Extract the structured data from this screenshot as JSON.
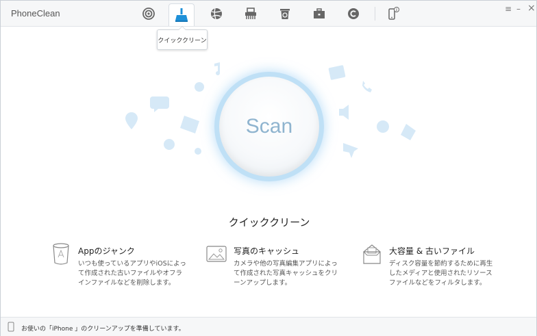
{
  "app": {
    "title": "PhoneClean"
  },
  "toolbar": {
    "items": [
      {
        "icon": "antenna-icon"
      },
      {
        "icon": "broom-icon",
        "active": true
      },
      {
        "icon": "globe-icon"
      },
      {
        "icon": "shredder-icon"
      },
      {
        "icon": "trash-recycle-icon"
      },
      {
        "icon": "toolbox-icon"
      },
      {
        "icon": "refresh-c-icon"
      },
      {
        "icon": "phone-info-icon"
      }
    ],
    "tooltip": "クイッククリーン"
  },
  "window_controls": {
    "menu": "≡",
    "minimize": "–",
    "close": "×"
  },
  "main": {
    "scan_label": "Scan",
    "section_title": "クイッククリーン",
    "features": [
      {
        "icon": "app-trash-icon",
        "title": "Appのジャンク",
        "desc": "いつも使っているアプリやiOSによって作成された古いファイルやオフラインファイルなどを削除します。"
      },
      {
        "icon": "photo-icon",
        "title": "写真のキャッシュ",
        "desc": "カメラや他の写真編集アプリによって作成された写真キャッシュをクリーンアップします。"
      },
      {
        "icon": "storage-box-icon",
        "title": "大容量 & 古いファイル",
        "desc": "ディスク容量を節約するために再生したメディアと使用されたリソースファイルなどをフィルタします。"
      }
    ]
  },
  "status": {
    "text": "お使いの「iPhone 」のクリーンアップを準備しています。"
  },
  "colors": {
    "accent": "#1e90d8",
    "scan_ring": "#bfe0f6",
    "scan_text": "#8fb4cf"
  }
}
